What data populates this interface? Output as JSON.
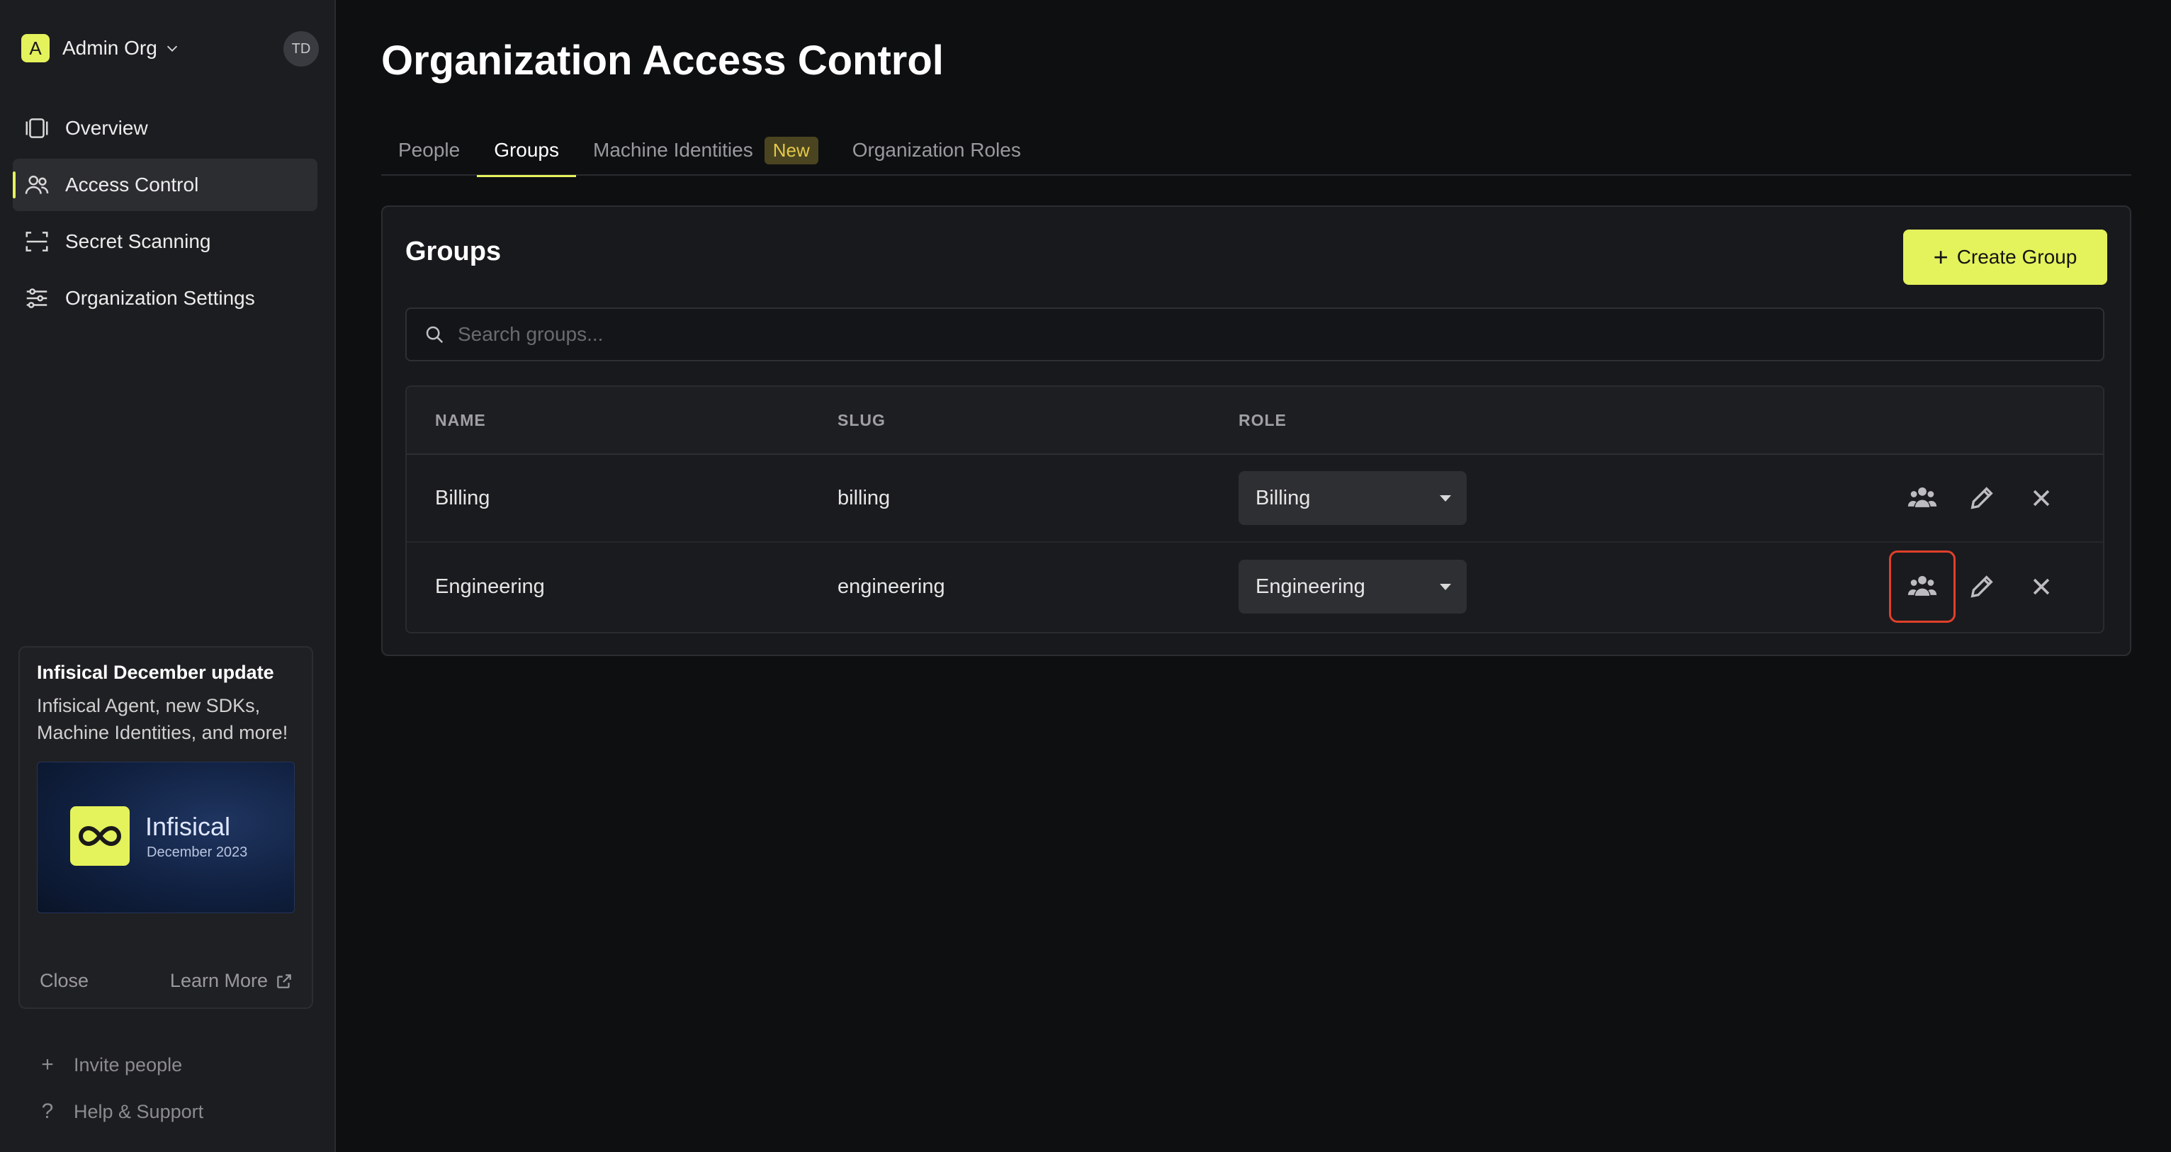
{
  "sidebar": {
    "org_initial": "A",
    "org_name": "Admin Org",
    "avatar_initials": "TD",
    "nav": [
      {
        "label": "Overview",
        "icon": "overview-icon"
      },
      {
        "label": "Access Control",
        "icon": "users-icon",
        "active": true
      },
      {
        "label": "Secret Scanning",
        "icon": "scan-icon"
      },
      {
        "label": "Organization Settings",
        "icon": "sliders-icon"
      }
    ],
    "update": {
      "title": "Infisical December update",
      "text": "Infisical Agent, new SDKs, Machine Identities, and more!",
      "banner_name": "Infisical",
      "banner_sub": "December 2023",
      "close_label": "Close",
      "learn_more_label": "Learn More"
    },
    "footer": {
      "invite_label": "Invite people",
      "help_label": "Help & Support"
    }
  },
  "main": {
    "title": "Organization Access Control",
    "tabs": [
      {
        "label": "People"
      },
      {
        "label": "Groups",
        "active": true
      },
      {
        "label": "Machine Identities",
        "badge": "New"
      },
      {
        "label": "Organization Roles"
      }
    ],
    "panel": {
      "title": "Groups",
      "create_label": "Create Group",
      "search_placeholder": "Search groups...",
      "columns": [
        "NAME",
        "SLUG",
        "ROLE"
      ],
      "rows": [
        {
          "name": "Billing",
          "slug": "billing",
          "role": "Billing"
        },
        {
          "name": "Engineering",
          "slug": "engineering",
          "role": "Engineering"
        }
      ]
    }
  },
  "colors": {
    "accent": "#e4f25c",
    "highlight": "#e0402a",
    "background": "#0e0f11",
    "sidebar": "#1c1d20"
  }
}
